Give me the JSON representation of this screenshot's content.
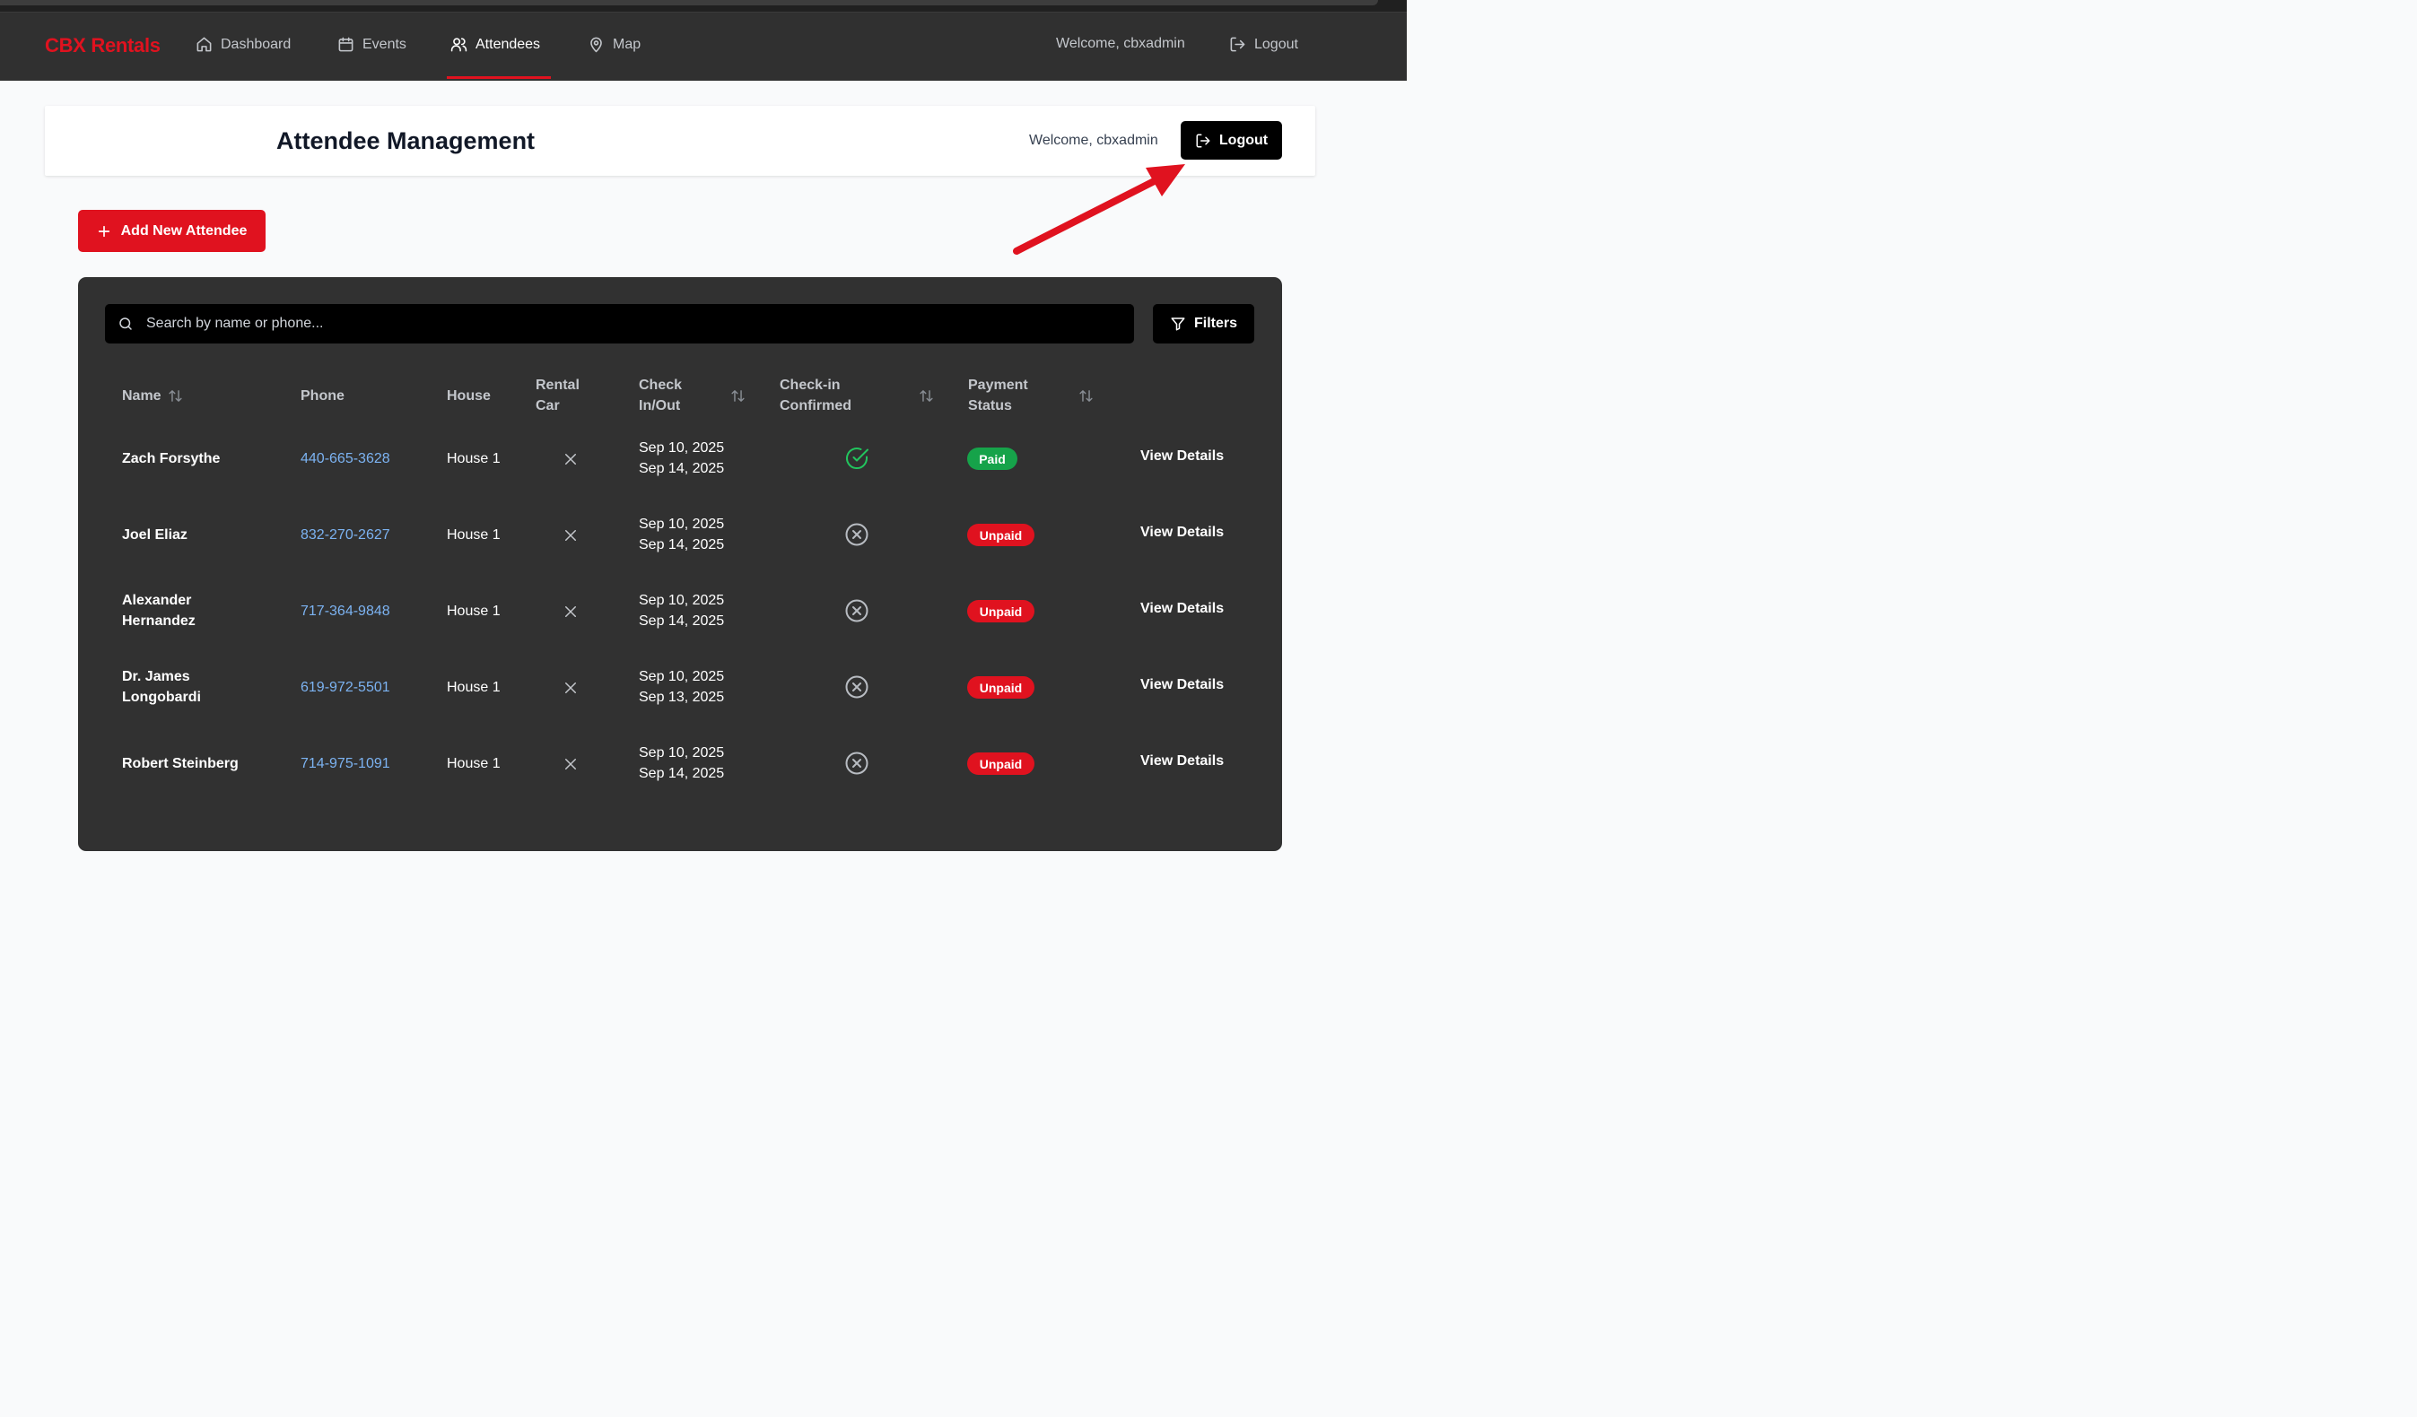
{
  "brand": "CBX Rentals",
  "nav": {
    "items": [
      {
        "label": "Dashboard",
        "icon": "home-icon"
      },
      {
        "label": "Events",
        "icon": "calendar-icon"
      },
      {
        "label": "Attendees",
        "icon": "users-icon",
        "active": true
      },
      {
        "label": "Map",
        "icon": "map-pin-icon"
      }
    ],
    "welcome": "Welcome, cbxadmin",
    "logout": "Logout"
  },
  "header": {
    "title": "Attendee Management",
    "welcome": "Welcome, cbxadmin",
    "logout": "Logout"
  },
  "add_button": "Add New Attendee",
  "search": {
    "placeholder": "Search by name or phone..."
  },
  "filters_button": "Filters",
  "table": {
    "headers": {
      "name": "Name",
      "phone": "Phone",
      "house": "House",
      "rental_car_1": "Rental",
      "rental_car_2": "Car",
      "check_1": "Check",
      "check_2": "In/Out",
      "confirmed_1": "Check-in",
      "confirmed_2": "Confirmed",
      "payment_1": "Payment",
      "payment_2": "Status"
    },
    "rows": [
      {
        "name_1": "Zach Forsythe",
        "name_2": "",
        "phone": "440-665-3628",
        "house": "House 1",
        "rental_car": false,
        "check_in": "Sep 10, 2025",
        "check_out": "Sep 14, 2025",
        "confirmed": true,
        "payment": "Paid",
        "action": "View Details"
      },
      {
        "name_1": "Joel Eliaz",
        "name_2": "",
        "phone": "832-270-2627",
        "house": "House 1",
        "rental_car": false,
        "check_in": "Sep 10, 2025",
        "check_out": "Sep 14, 2025",
        "confirmed": false,
        "payment": "Unpaid",
        "action": "View Details"
      },
      {
        "name_1": "Alexander",
        "name_2": "Hernandez",
        "phone": "717-364-9848",
        "house": "House 1",
        "rental_car": false,
        "check_in": "Sep 10, 2025",
        "check_out": "Sep 14, 2025",
        "confirmed": false,
        "payment": "Unpaid",
        "action": "View Details"
      },
      {
        "name_1": "Dr. James",
        "name_2": "Longobardi",
        "phone": "619-972-5501",
        "house": "House 1",
        "rental_car": false,
        "check_in": "Sep 10, 2025",
        "check_out": "Sep 13, 2025",
        "confirmed": false,
        "payment": "Unpaid",
        "action": "View Details"
      },
      {
        "name_1": "Robert Steinberg",
        "name_2": "",
        "phone": "714-975-1091",
        "house": "House 1",
        "rental_car": false,
        "check_in": "Sep 10, 2025",
        "check_out": "Sep 14, 2025",
        "confirmed": false,
        "payment": "Unpaid",
        "action": "View Details"
      }
    ]
  },
  "colors": {
    "brand_red": "#e0121f",
    "nav_bg": "#303030",
    "panel_bg": "#313131",
    "paid_green": "#16a34a",
    "link_blue": "#7cb3f2"
  }
}
